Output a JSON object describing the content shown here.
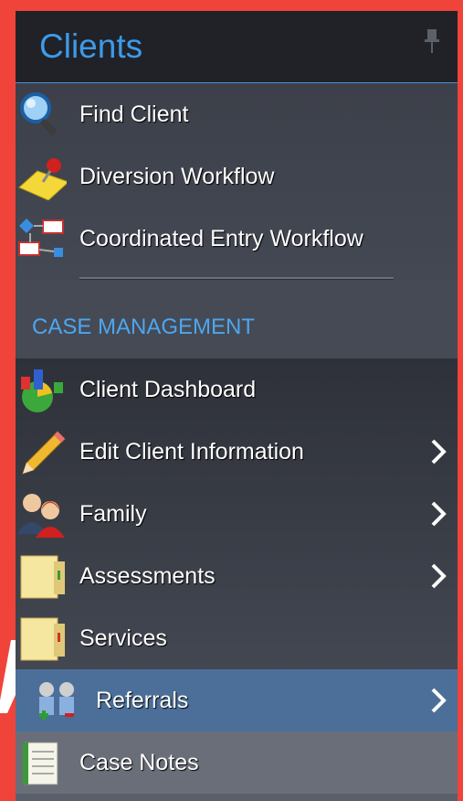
{
  "header": {
    "title": "Clients"
  },
  "top_items": [
    {
      "label": "Find Client",
      "icon": "magnifier-icon"
    },
    {
      "label": "Diversion Workflow",
      "icon": "pushpin-note-icon"
    },
    {
      "label": "Coordinated Entry Workflow",
      "icon": "workflow-diagram-icon"
    }
  ],
  "section": {
    "title": "CASE MANAGEMENT"
  },
  "case_items": [
    {
      "label": "Client Dashboard",
      "icon": "dashboard-chart-icon",
      "has_submenu": false
    },
    {
      "label": "Edit Client Information",
      "icon": "pencil-icon",
      "has_submenu": true
    },
    {
      "label": "Family",
      "icon": "family-people-icon",
      "has_submenu": true
    },
    {
      "label": "Assessments",
      "icon": "folder-icon",
      "has_submenu": true
    },
    {
      "label": "Services",
      "icon": "folder-icon",
      "has_submenu": false
    },
    {
      "label": "Referrals",
      "icon": "referral-people-icon",
      "has_submenu": true,
      "selected": true
    },
    {
      "label": "Case Notes",
      "icon": "notebook-icon",
      "has_submenu": false
    }
  ],
  "colors": {
    "accent": "#3d9be9",
    "selected": "#4b6f99",
    "border": "#f0443a"
  }
}
